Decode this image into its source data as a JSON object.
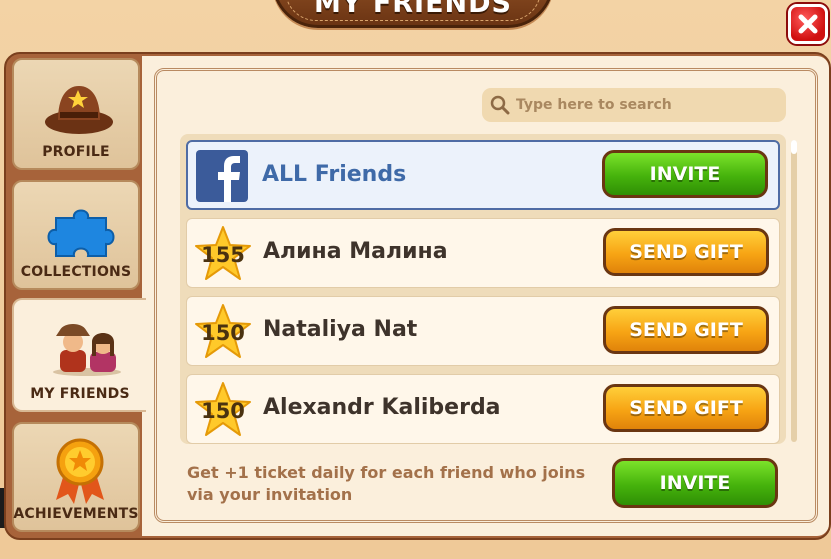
{
  "title": "MY FRIENDS",
  "tabs": [
    {
      "label": "PROFILE",
      "icon": "cowboy-hat-icon"
    },
    {
      "label": "COLLECTIONS",
      "icon": "puzzle-piece-icon"
    },
    {
      "label": "MY FRIENDS",
      "icon": "friends-icon",
      "active": true
    },
    {
      "label": "ACHIEVEMENTS",
      "icon": "medal-icon"
    }
  ],
  "search": {
    "placeholder": "Type here to search"
  },
  "all_friends": {
    "label": "ALL Friends",
    "button": "INVITE"
  },
  "friends": [
    {
      "level": "155",
      "name": "Алина Малина",
      "button": "SEND GIFT"
    },
    {
      "level": "150",
      "name": "Nataliya Nat",
      "button": "SEND GIFT"
    },
    {
      "level": "150",
      "name": "Alexandr Kaliberda",
      "button": "SEND GIFT"
    }
  ],
  "footer": {
    "text": "Get +1 ticket daily for each friend who joins via your invitation",
    "button": "INVITE"
  },
  "colors": {
    "frame": "#a7633a",
    "panel": "#fbefdc",
    "green_button": "#46b30c",
    "orange_button": "#f7a414",
    "facebook": "#3b5b9a",
    "close": "#d01010"
  }
}
